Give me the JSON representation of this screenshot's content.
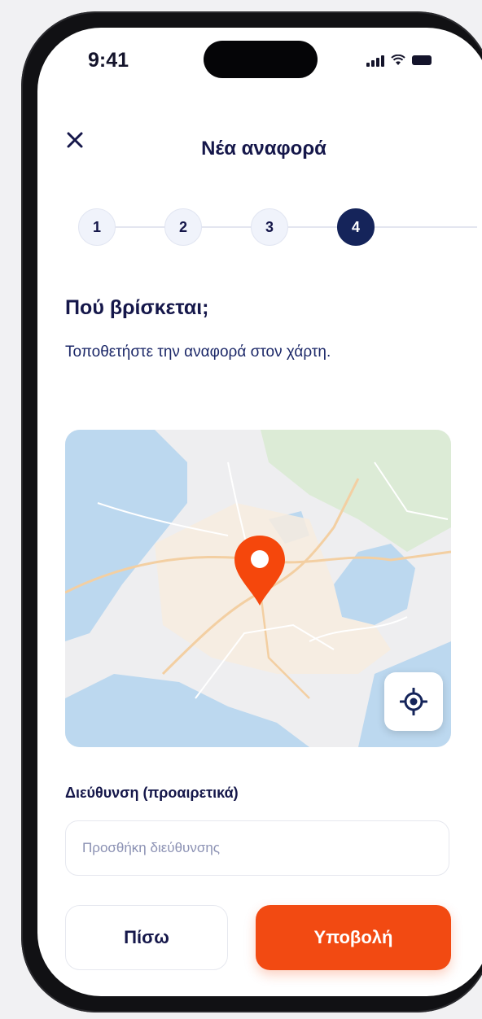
{
  "status_bar": {
    "time": "9:41"
  },
  "header": {
    "title": "Νέα αναφορά",
    "close_icon": "close-icon"
  },
  "stepper": {
    "steps": [
      "1",
      "2",
      "3",
      "4"
    ],
    "active_step": "4"
  },
  "content": {
    "heading": "Πού βρίσκεται;",
    "subtitle": "Τοποθετήστε την αναφορά στον χάρτη."
  },
  "map": {
    "pin_icon": "location-pin-icon",
    "locate_icon": "locate-me-icon",
    "colors": {
      "land": "#eeeef0",
      "water": "#bcd8ef",
      "park": "#dcebd6",
      "roads": "#f6d9b3",
      "pin": "#f5470c"
    }
  },
  "address": {
    "label": "Διεύθυνση (προαιρετικά)",
    "placeholder": "Προσθήκη διεύθυνσης",
    "value": ""
  },
  "actions": {
    "back_label": "Πίσω",
    "submit_label": "Υποβολή"
  },
  "colors": {
    "primary": "#15245a",
    "accent": "#f24a12",
    "text": "#15174a"
  }
}
